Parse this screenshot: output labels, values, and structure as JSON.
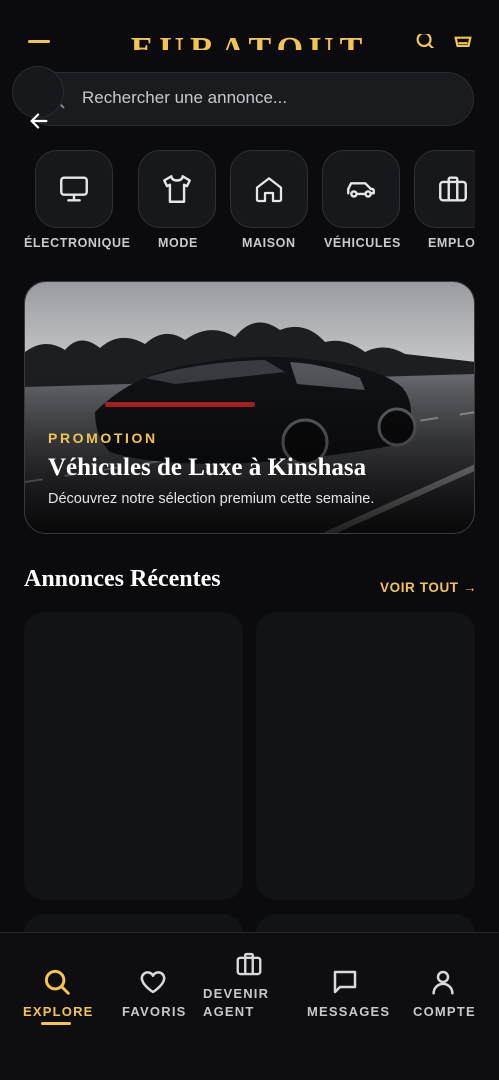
{
  "header": {
    "brand": "EURATOUT",
    "menu_icon": "menu-icon",
    "search_action_icon": "search-icon",
    "cart_icon": "cart-icon"
  },
  "search": {
    "placeholder": "Rechercher une annonce...",
    "icon": "search-icon",
    "back_icon": "arrow-left-icon"
  },
  "categories": [
    {
      "label": "ÉLECTRONIQUE",
      "icon": "monitor-icon"
    },
    {
      "label": "MODE",
      "icon": "shirt-icon"
    },
    {
      "label": "MAISON",
      "icon": "home-icon"
    },
    {
      "label": "VÉHICULES",
      "icon": "car-icon"
    },
    {
      "label": "EMPLOI",
      "icon": "briefcase-icon"
    }
  ],
  "promo": {
    "tag": "PROMOTION",
    "title": "Véhicules de Luxe à Kinshasa",
    "subtitle": "Découvrez notre sélection premium cette semaine."
  },
  "recent": {
    "title": "Annonces Récentes",
    "see_all": "VOIR TOUT →"
  },
  "nav": {
    "items": [
      {
        "label": "EXPLORE",
        "icon": "search-icon",
        "active": true
      },
      {
        "label": "FAVORIS",
        "icon": "heart-icon"
      },
      {
        "label": "DEVENIR\nAGENT",
        "line1": "DEVENIR",
        "line2": "AGENT",
        "icon": "briefcase-icon"
      },
      {
        "label": "MESSAGES",
        "icon": "message-icon"
      },
      {
        "label": "COMPTE",
        "icon": "user-icon"
      }
    ]
  },
  "colors": {
    "accent": "#f1c453",
    "background": "#0b0b0d",
    "surface": "#17181c"
  }
}
